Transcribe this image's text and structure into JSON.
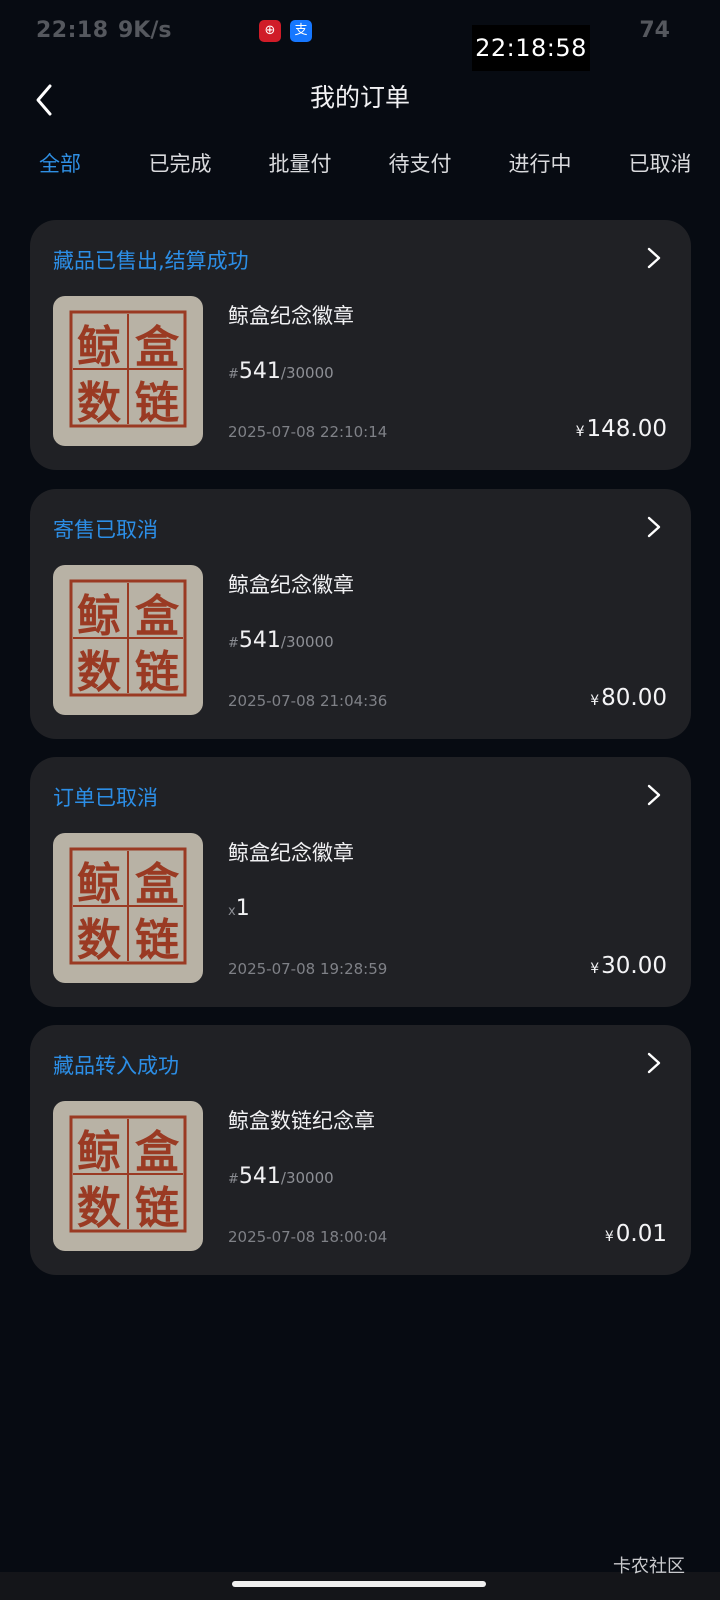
{
  "status_bar": {
    "time": "22:18",
    "speed": "9K/s",
    "battery": "74",
    "clock_overlay": "22:18:58"
  },
  "header": {
    "title": "我的订单"
  },
  "tabs": [
    {
      "label": "全部",
      "active": true
    },
    {
      "label": "已完成",
      "active": false
    },
    {
      "label": "批量付",
      "active": false
    },
    {
      "label": "待支付",
      "active": false
    },
    {
      "label": "进行中",
      "active": false
    },
    {
      "label": "已取消",
      "active": false
    }
  ],
  "orders": [
    {
      "status": "藏品已售出,结算成功",
      "name": "鲸盒纪念徽章",
      "serial_prefix": "#",
      "serial_number": "541",
      "serial_total": "/30000",
      "date": "2025-07-08 22:10:14",
      "currency": "¥",
      "price": "148.00"
    },
    {
      "status": "寄售已取消",
      "name": "鲸盒纪念徽章",
      "serial_prefix": "#",
      "serial_number": "541",
      "serial_total": "/30000",
      "date": "2025-07-08 21:04:36",
      "currency": "¥",
      "price": "80.00"
    },
    {
      "status": "订单已取消",
      "name": "鲸盒纪念徽章",
      "serial_prefix": "x",
      "serial_number": "1",
      "serial_total": "",
      "date": "2025-07-08 19:28:59",
      "currency": "¥",
      "price": "30.00"
    },
    {
      "status": "藏品转入成功",
      "name": "鲸盒数链纪念章",
      "serial_prefix": "#",
      "serial_number": "541",
      "serial_total": "/30000",
      "date": "2025-07-08 18:00:04",
      "currency": "¥",
      "price": "0.01"
    }
  ],
  "seal_chars": [
    "鲸",
    "盒",
    "数",
    "链"
  ],
  "watermark": "卡农社区",
  "colors": {
    "background": "#070b12",
    "card": "#202125",
    "accent_blue": "#2f8fe3",
    "seal_red": "#9a3a23",
    "seal_paper": "#b8b2a5"
  }
}
